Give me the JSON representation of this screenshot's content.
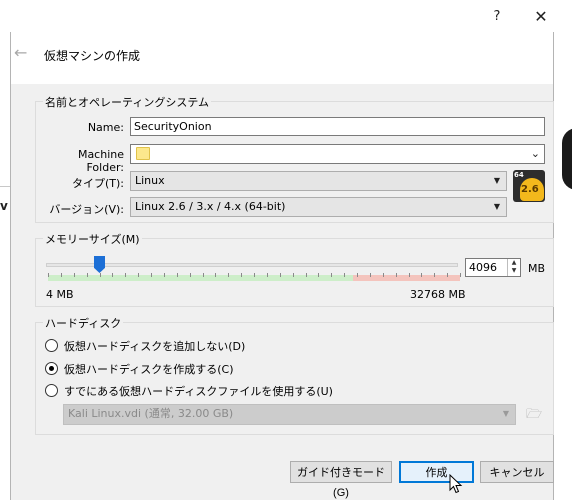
{
  "window": {
    "help_label": "?",
    "close_label": "✕",
    "title": "仮想マシンの作成",
    "back_icon": "back-arrow-icon"
  },
  "background": {
    "left_char": "v"
  },
  "name_os": {
    "group_title": "名前とオペレーティングシステム",
    "name_label": "Name:",
    "name_value": "SecurityOnion",
    "folder_label": "Machine Folder:",
    "folder_value": "",
    "type_label": "タイプ(T):",
    "type_value": "Linux",
    "version_label": "バージョン(V):",
    "version_value": "Linux 2.6 / 3.x / 4.x (64-bit)",
    "os_icon_badge": "64",
    "os_icon_version": "2.6"
  },
  "memory": {
    "group_title": "メモリーサイズ(M)",
    "min_label": "4 MB",
    "max_label": "32768 MB",
    "value": "4096",
    "unit": "MB",
    "slider_level_mb": 4096,
    "recommended_max_mb": 24576
  },
  "disk": {
    "group_title": "ハードディスク",
    "options": [
      {
        "label": "仮想ハードディスクを追加しない(D)",
        "checked": false
      },
      {
        "label": "仮想ハードディスクを作成する(C)",
        "checked": true
      },
      {
        "label": "すでにある仮想ハードディスクファイルを使用する(U)",
        "checked": false
      }
    ],
    "existing_file": "Kali Linux.vdi (通常, 32.00 GB)"
  },
  "buttons": {
    "guided": "ガイド付きモード(G)",
    "create": "作成",
    "cancel": "キャンセル"
  },
  "colors": {
    "slider_handle": "#1c6fd6",
    "green_zone": "#cdeec9",
    "red_zone": "#f4c4bd",
    "default_button_border": "#0078d7"
  }
}
